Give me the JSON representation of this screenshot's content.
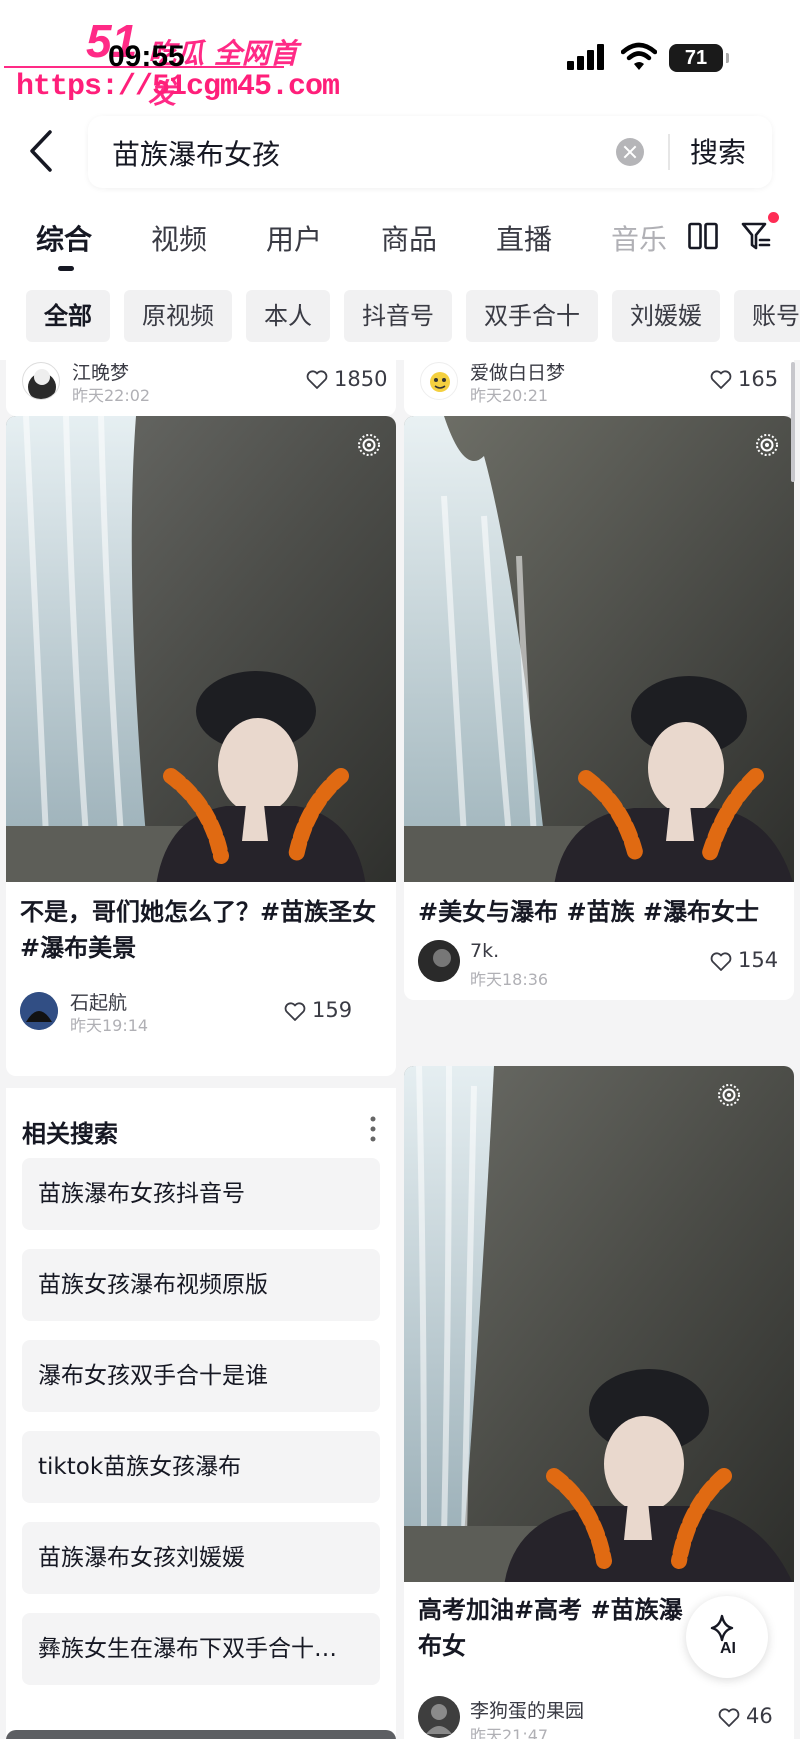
{
  "status_bar": {
    "time": "09:55",
    "battery": "71"
  },
  "watermark": {
    "logo": "51",
    "title": "吃瓜 全网首发",
    "url": "https://51cgm45.com"
  },
  "search": {
    "query": "苗族瀑布女孩",
    "button": "搜索"
  },
  "tabs": [
    "综合",
    "视频",
    "用户",
    "商品",
    "直播",
    "音乐"
  ],
  "chips": [
    "全部",
    "原视频",
    "本人",
    "抖音号",
    "双手合十",
    "刘媛媛",
    "账号"
  ],
  "feed": {
    "top_left": {
      "author": "江晚梦",
      "date": "昨天22:02",
      "likes": "1850"
    },
    "top_right": {
      "author": "爱做白日梦",
      "date": "昨天20:21",
      "likes": "165"
    },
    "card1": {
      "caption": "不是，哥们她怎么了？#苗族圣女 #瀑布美景",
      "author": "石起航",
      "date": "昨天19:14",
      "likes": "159"
    },
    "card2": {
      "caption": "#美女与瀑布 #苗族 #瀑布女士",
      "author": "7k.",
      "date": "昨天18:36",
      "likes": "154"
    },
    "card3": {
      "caption": "高考加油#高考 #苗族瀑布女",
      "author": "李狗蛋的果园",
      "date": "昨天21:47",
      "likes": "46"
    }
  },
  "related": {
    "title": "相关搜索",
    "items": [
      "苗族瀑布女孩抖音号",
      "苗族女孩瀑布视频原版",
      "瀑布女孩双手合十是谁",
      "tiktok苗族女孩瀑布",
      "苗族瀑布女孩刘媛媛",
      "彝族女生在瀑布下双手合十…"
    ]
  },
  "ai_button": "AI",
  "colors": {
    "accent": "#fe2c55",
    "watermark": "#ff2a86"
  }
}
